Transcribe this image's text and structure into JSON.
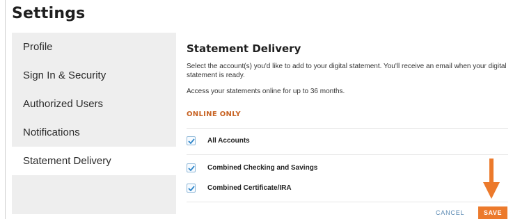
{
  "page": {
    "title": "Settings"
  },
  "sidebar": {
    "items": [
      {
        "label": "Profile"
      },
      {
        "label": "Sign In & Security"
      },
      {
        "label": "Authorized Users"
      },
      {
        "label": "Notifications"
      },
      {
        "label": "Statement Delivery",
        "active": true
      }
    ]
  },
  "statement_delivery": {
    "title": "Statement Delivery",
    "description": "Select the account(s) you'd like to add to your digital statement. You'll receive an email when your digital statement is ready.",
    "access_note": "Access your statements online for up to 36 months.",
    "section_label": "ONLINE ONLY",
    "accounts": [
      {
        "label": "All Accounts",
        "checked": true
      },
      {
        "label": "Combined Checking and Savings",
        "checked": true
      },
      {
        "label": "Combined Certificate/IRA",
        "checked": true
      }
    ]
  },
  "actions": {
    "cancel_label": "CANCEL",
    "save_label": "SAVE"
  },
  "colors": {
    "accent": "#ec7a2c",
    "link": "#5b8ab3",
    "section_label": "#c86323",
    "check": "#2e86c9"
  },
  "icons": {
    "checkbox": "check-icon",
    "pointer": "down-arrow-icon"
  }
}
